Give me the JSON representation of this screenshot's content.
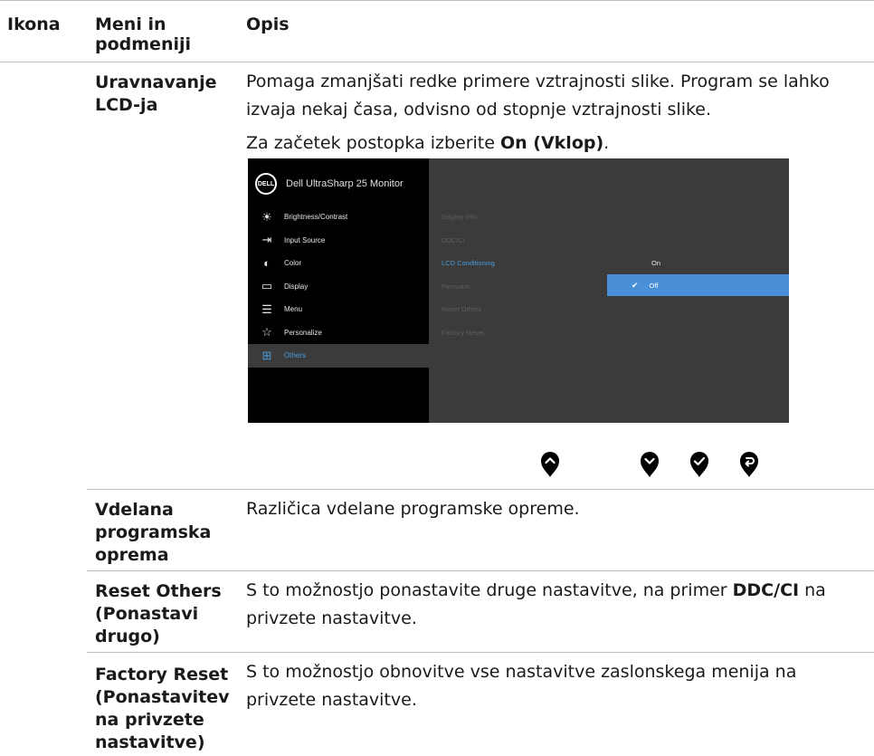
{
  "header": {
    "col1": "Ikona",
    "col2": "Meni in podmeniji",
    "col3": "Opis"
  },
  "rows": [
    {
      "term": "Uravnavanje LCD-ja",
      "desc1": "Pomaga zmanjšati redke primere vztrajnosti slike. Program se lahko izvaja nekaj časa, odvisno od stopnje vztrajnosti slike.",
      "desc2_pre": "Za začetek postopka izberite ",
      "desc2_bold": "On (Vklop)",
      "desc2_post": "."
    },
    {
      "term": "Vdelana programska oprema",
      "desc": "Različica vdelane programske opreme."
    },
    {
      "term": "Reset Others (Ponastavi drugo)",
      "desc_pre": "S to možnostjo ponastavite druge nastavitve, na primer ",
      "desc_bold": "DDC/CI",
      "desc_post": " na privzete nastavitve."
    },
    {
      "term": "Factory Reset (Ponastavitev na privzete nastavitve)",
      "desc": "S to možnostjo obnovitve vse nastavitve zaslonskega menija na privzete nastavitve."
    }
  ],
  "osd": {
    "logo": "DELL",
    "title": "Dell UltraSharp 25 Monitor",
    "menu": [
      {
        "icon": "brightness-icon",
        "glyph": "☀",
        "label": "Brightness/Contrast"
      },
      {
        "icon": "input-source-icon",
        "glyph": "⇥",
        "label": "Input Source"
      },
      {
        "icon": "color-icon",
        "glyph": "◐",
        "label": "Color"
      },
      {
        "icon": "display-icon",
        "glyph": "▭",
        "label": "Display"
      },
      {
        "icon": "menu-icon",
        "glyph": "☰",
        "label": "Menu"
      },
      {
        "icon": "star-icon",
        "glyph": "☆",
        "label": "Personalize"
      },
      {
        "icon": "others-icon",
        "glyph": "⊞",
        "label": "Others"
      }
    ],
    "submenu": [
      "Display Info",
      "DDC/CI",
      "LCD Conditioning",
      "Firmware",
      "Reset Others",
      "Factory Reset"
    ],
    "options": {
      "on": "On",
      "off": "Off"
    }
  },
  "buttons": [
    "up-button-icon",
    "down-button-icon",
    "check-button-icon",
    "back-button-icon"
  ]
}
